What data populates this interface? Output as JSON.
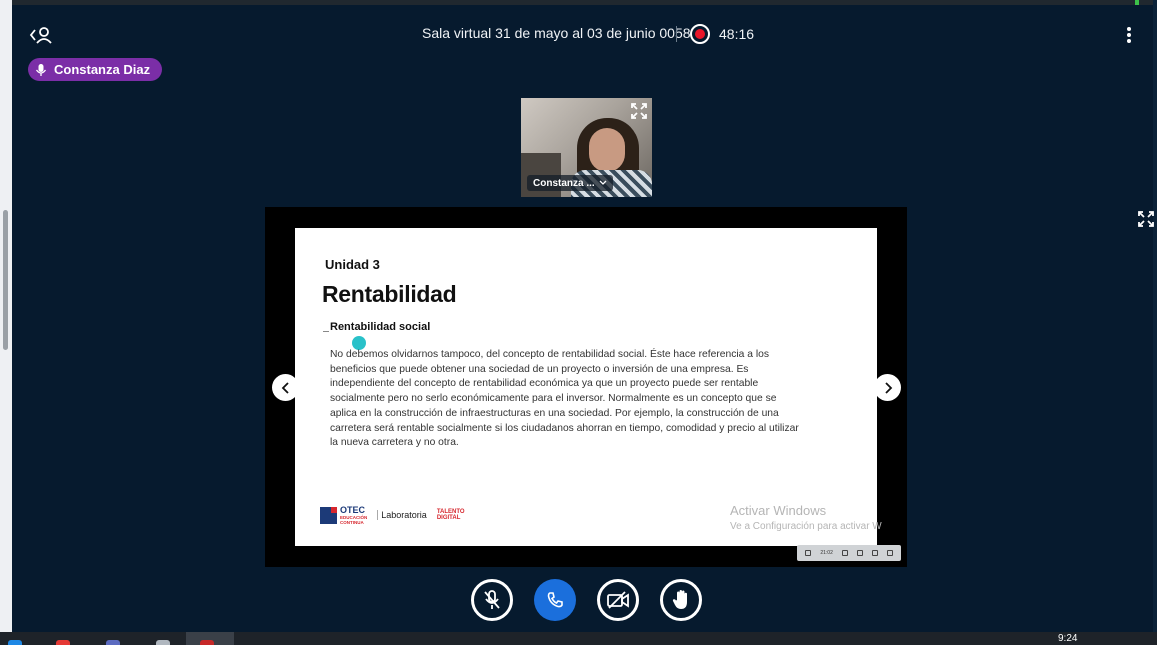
{
  "header": {
    "title": "Sala virtual 31 de mayo al 03 de junio 0058",
    "recording_time": "48:16"
  },
  "talking_indicator": {
    "name": "Constanza Diaz"
  },
  "webcam": {
    "name": "Constanza ..."
  },
  "slide": {
    "unit": "Unidad 3",
    "title": "Rentabilidad",
    "subtitle": "Rentabilidad social",
    "body": "No debemos olvidarnos tampoco, del concepto de rentabilidad social. Éste hace referencia a los beneficios que puede obtener una sociedad de un proyecto o inversión de una empresa. Es independiente del concepto de rentabilidad económica ya que un proyecto puede ser rentable socialmente pero no serlo económicamente para el inversor. Normalmente es un concepto que se aplica en la construcción de infraestructuras en una sociedad. Por ejemplo, la construcción de una carretera será rentable socialmente si los ciudadanos ahorran en tiempo, comodidad y precio al utilizar la nueva carretera y no otra.",
    "logos": {
      "otec": "OTEC",
      "otec_sub1": "EDUCACIÓN",
      "otec_sub2": "CONTINUA",
      "laboratoria": "Laboratoria",
      "talento_1": "TALENTO",
      "talento_2": "DIGITAL"
    },
    "watermark": {
      "line1": "Activar Windows",
      "line2": "Ve a Configuración para activar W"
    }
  },
  "player_bar": {
    "time": "21:02"
  },
  "taskbar": {
    "clock": "9:24"
  },
  "colors": {
    "background": "#061a2e",
    "talker_badge": "#7b2ea7",
    "recording": "#e8162a",
    "call_button": "#1b6fdc",
    "cursor_dot": "#29c1c9"
  },
  "icons": {
    "back": "chevron-left-user-icon",
    "record": "record-icon",
    "more": "kebab-menu-icon",
    "mic": "microphone-icon",
    "expand": "fullscreen-icon",
    "prev": "chevron-left-icon",
    "next": "chevron-right-icon",
    "mute": "microphone-off-icon",
    "phone": "phone-icon",
    "camera_off": "camera-off-icon",
    "hand": "raise-hand-icon"
  }
}
